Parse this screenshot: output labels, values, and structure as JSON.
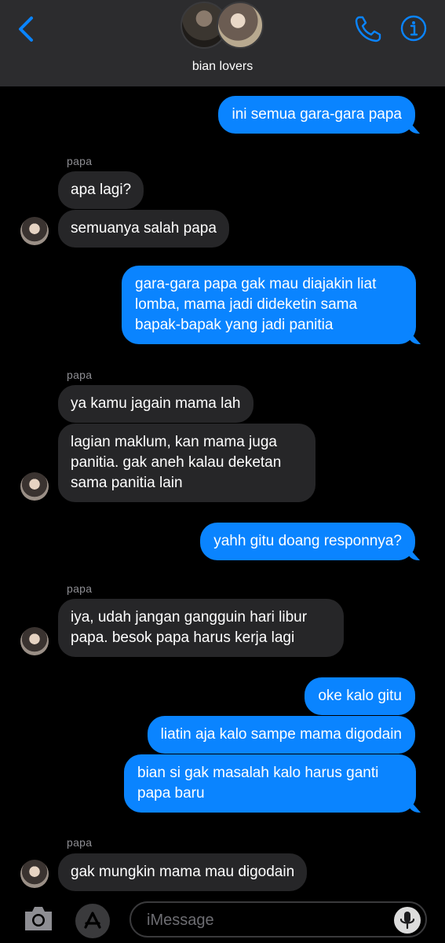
{
  "header": {
    "group_name": "bian lovers",
    "back_icon": "chevron-left-icon",
    "phone_icon": "phone-icon",
    "info_icon": "info-icon",
    "accent": "#0a84ff"
  },
  "messages": [
    {
      "from": "me",
      "text": "ini semua gara-gara papa"
    },
    {
      "from": "papa",
      "sender": "papa",
      "text": "apa lagi?"
    },
    {
      "from": "papa",
      "text": "semuanya salah papa"
    },
    {
      "from": "me",
      "text": "gara-gara papa gak mau diajakin liat lomba, mama jadi dideketin sama bapak-bapak yang jadi panitia"
    },
    {
      "from": "papa",
      "sender": "papa",
      "text": "ya kamu jagain mama lah"
    },
    {
      "from": "papa",
      "text": "lagian maklum, kan mama juga panitia. gak aneh kalau deketan sama panitia lain"
    },
    {
      "from": "me",
      "text": "yahh gitu doang responnya?"
    },
    {
      "from": "papa",
      "sender": "papa",
      "text": "iya, udah jangan gangguin hari libur papa. besok papa harus kerja lagi"
    },
    {
      "from": "me",
      "text": "oke kalo gitu"
    },
    {
      "from": "me",
      "text": "liatin aja kalo sampe mama digodain"
    },
    {
      "from": "me",
      "text": "bian si gak masalah kalo harus ganti papa baru"
    },
    {
      "from": "papa",
      "sender": "papa",
      "text": "gak mungkin mama mau digodain"
    }
  ],
  "composer": {
    "placeholder": "iMessage",
    "camera_icon": "camera-icon",
    "apps_icon": "app-store-icon",
    "mic_icon": "microphone-icon"
  }
}
